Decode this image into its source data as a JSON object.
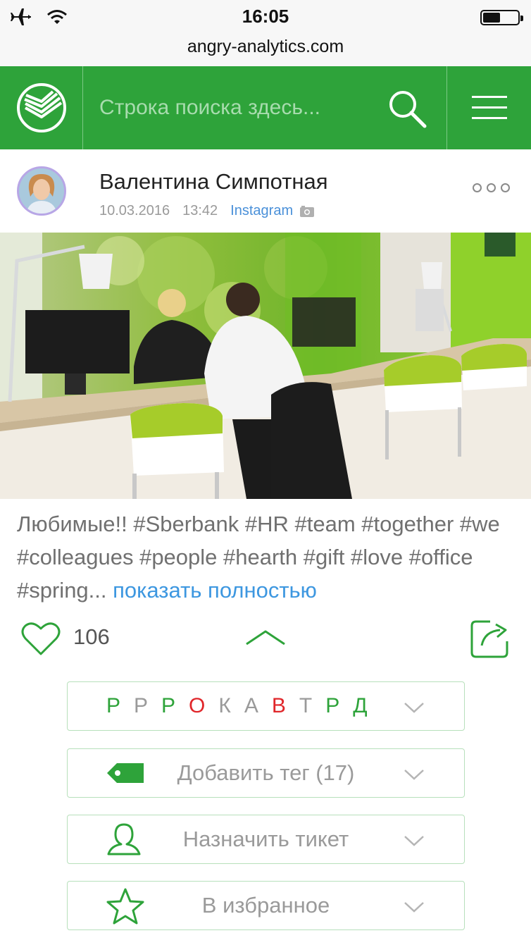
{
  "status_bar": {
    "time": "16:05",
    "url": "angry-analytics.com",
    "icons": [
      "airplane-icon",
      "wifi-icon",
      "battery-icon"
    ]
  },
  "header": {
    "logo": "sberbank-logo",
    "search_placeholder": "Строка поиска здесь...",
    "search_icon": "search-icon",
    "menu_icon": "hamburger-menu-icon",
    "brand_color": "#2ea33a"
  },
  "post": {
    "author": "Валентина Симпотная",
    "date": "10.03.2016",
    "time": "13:42",
    "source": "Instagram",
    "caption": "Любимые!! #Sberbank #HR #team #together #we #colleagues #people #hearth #gift #love #office #spring...",
    "show_more": "показать полностью",
    "likes": "106"
  },
  "tone_row": {
    "letters": [
      {
        "char": "Р",
        "color": "#2ea33a"
      },
      {
        "char": "Р",
        "color": "#9a9a9a"
      },
      {
        "char": "Р",
        "color": "#2ea33a"
      },
      {
        "char": "О",
        "color": "#e0262a"
      },
      {
        "char": "К",
        "color": "#9a9a9a"
      },
      {
        "char": "А",
        "color": "#9a9a9a"
      },
      {
        "char": "В",
        "color": "#e0262a"
      },
      {
        "char": "Т",
        "color": "#9a9a9a"
      },
      {
        "char": "Р",
        "color": "#2ea33a"
      },
      {
        "char": "Д",
        "color": "#2ea33a"
      }
    ]
  },
  "rows": {
    "add_tag": "Добавить тег (17)",
    "assign_ticket": "Назначить тикет",
    "favorites": "В избранное"
  }
}
